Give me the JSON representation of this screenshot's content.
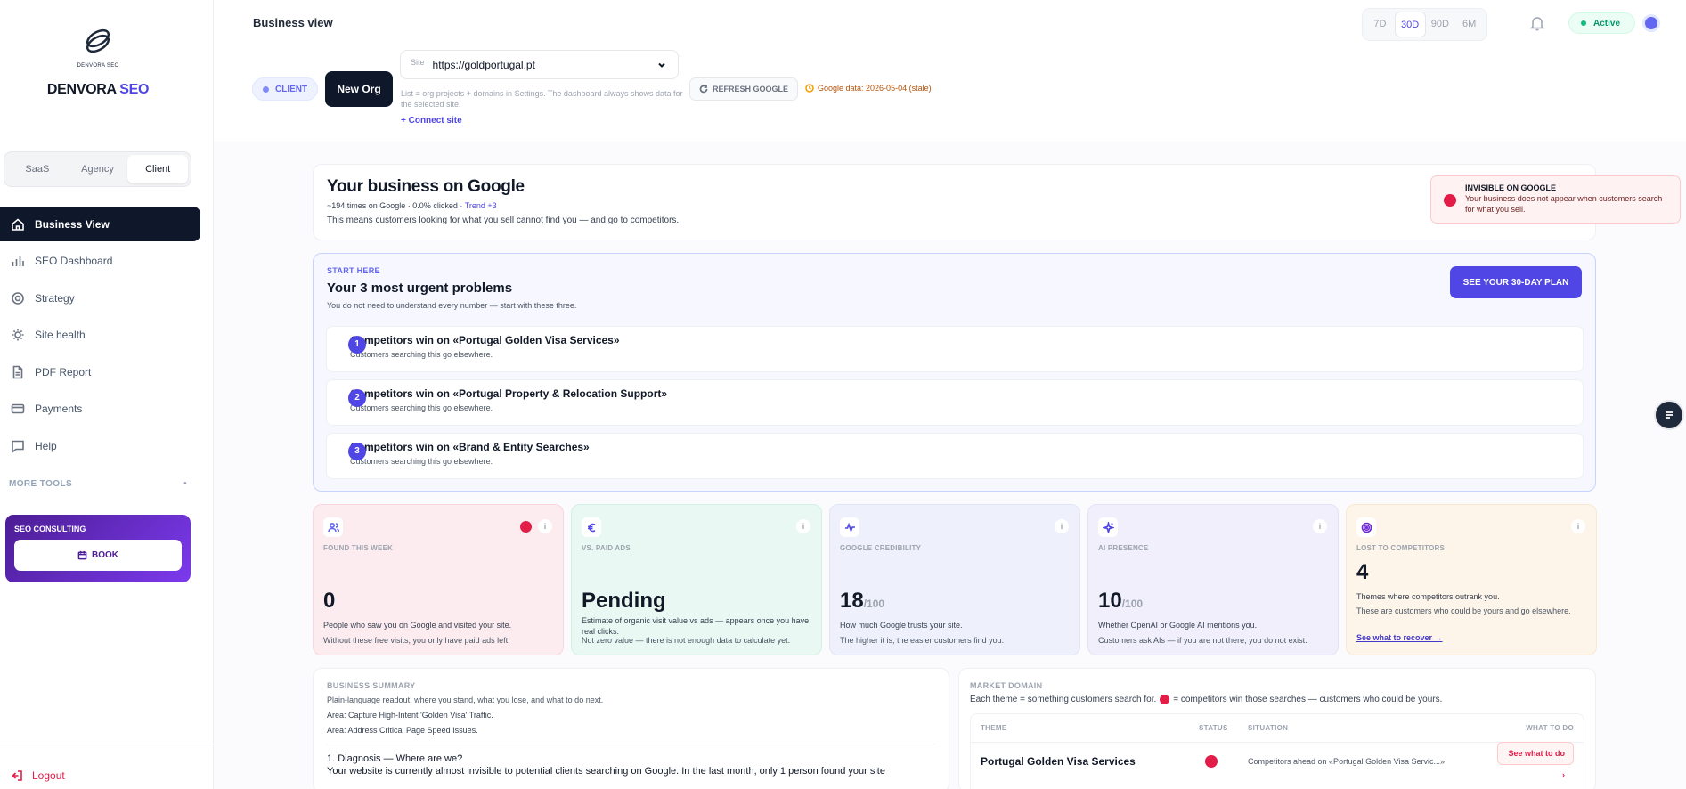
{
  "sidebar": {
    "logo_small": "DENVORA SEO",
    "brand_main": "DENVORA",
    "brand_seo": "SEO",
    "modes": [
      "SaaS",
      "Agency",
      "Client"
    ],
    "nav": [
      {
        "label": "Business View",
        "icon": "home-icon"
      },
      {
        "label": "SEO Dashboard",
        "icon": "bar-chart-icon"
      },
      {
        "label": "Strategy",
        "icon": "target-icon"
      },
      {
        "label": "Site health",
        "icon": "sun-icon"
      },
      {
        "label": "PDF Report",
        "icon": "file-icon"
      },
      {
        "label": "Payments",
        "icon": "card-icon"
      },
      {
        "label": "Help",
        "icon": "chat-icon"
      }
    ],
    "more_tools": "MORE TOOLS",
    "more_tools_indicator": "•",
    "consulting_title": "SEO CONSULTING",
    "book_label": "BOOK",
    "logout": "Logout"
  },
  "header": {
    "title": "Business view",
    "ranges": [
      "7D",
      "30D",
      "90D",
      "6M"
    ],
    "selected_range": "30D",
    "status": "Active",
    "client_badge": "CLIENT",
    "new_org": "New Org",
    "site_label": "Site",
    "site_value": "https://goldportugal.pt",
    "site_help": "List = org projects + domains in Settings. The dashboard always shows data for the selected site.",
    "connect_site": "+ Connect site",
    "refresh_google": "REFRESH GOOGLE",
    "google_data": "Google data: 2026-05-04 (stale)"
  },
  "hero": {
    "title": "Your business on Google",
    "sub": "~194 times on Google · 0.0% clicked",
    "trend": "· Trend +3",
    "desc": "This means customers looking for what you sell cannot find you — and go to competitors.",
    "alert_title": "INVISIBLE ON GOOGLE",
    "alert_text": "Your business does not appear when customers search for what you sell."
  },
  "urgent": {
    "kicker": "START HERE",
    "title": "Your 3 most urgent problems",
    "sub": "You do not need to understand every number — start with these three.",
    "plan_button": "SEE YOUR 30-DAY PLAN",
    "problems": [
      {
        "num": "1",
        "title": "Competitors win on «Portugal Golden Visa Services»",
        "sub": "Customers searching this go elsewhere."
      },
      {
        "num": "2",
        "title": "Competitors win on «Portugal Property & Relocation Support»",
        "sub": "Customers searching this go elsewhere."
      },
      {
        "num": "3",
        "title": "Competitors win on «Brand & Entity Searches»",
        "sub": "Customers searching this go elsewhere."
      }
    ]
  },
  "kpis": [
    {
      "label": "FOUND THIS WEEK",
      "value": "0",
      "unit": "",
      "desc": "People who saw you on Google and visited your site.",
      "note": "Without these free visits, you only have paid ads left.",
      "bg": "#fdecef",
      "icon": "users-icon",
      "color": "#6366f1"
    },
    {
      "label": "VS. PAID ADS",
      "value": "Pending",
      "unit": "",
      "desc": "Estimate of organic visit value vs ads — appears once you have real clicks.",
      "note": "Not zero value — there is not enough data to calculate yet.",
      "bg": "#e9f8f2",
      "icon": "euro-icon",
      "color": "#4f46e5"
    },
    {
      "label": "GOOGLE CREDIBILITY",
      "value": "18",
      "unit": "/100",
      "desc": "How much Google trusts your site.",
      "note": "The higher it is, the easier customers find you.",
      "bg": "#eef1fb",
      "icon": "pulse-icon",
      "color": "#4f46e5"
    },
    {
      "label": "AI PRESENCE",
      "value": "10",
      "unit": "/100",
      "desc": "Whether OpenAI or Google AI mentions you.",
      "note": "Customers ask AIs — if you are not there, you do not exist.",
      "bg": "#f0effb",
      "icon": "sparkle-icon",
      "color": "#4f46e5"
    },
    {
      "label": "LOST TO COMPETITORS",
      "value": "4",
      "unit": "",
      "desc": "Themes where competitors outrank you.",
      "note": "These are customers who could be yours and go elsewhere.",
      "link": "See what to recover →",
      "bg": "#fdf5ea",
      "icon": "target-icon",
      "color": "#6d28d9"
    }
  ],
  "summary": {
    "label": "BUSINESS SUMMARY",
    "sub": "Plain-language readout: where you stand, what you lose, and what to do next.",
    "area1": "Area: Capture High-Intent 'Golden Visa' Traffic.",
    "area2": "Area: Address Critical Page Speed Issues.",
    "heading": "1. Diagnosis — Where are we?",
    "para": "Your website is currently almost invisible to potential clients searching on Google. In the last month, only 1 person found your site"
  },
  "market": {
    "label": "MARKET DOMAIN",
    "sub_a": "Each theme = something customers search for.",
    "sub_b": "= competitors win those searches — customers who could be yours.",
    "columns": [
      "THEME",
      "STATUS",
      "SITUATION",
      "WHAT TO DO"
    ],
    "rows": [
      {
        "theme": "Portugal Golden Visa Services",
        "situation": "Competitors ahead on «Portugal Golden Visa Servic...»",
        "action": "See what to do ›"
      }
    ]
  }
}
